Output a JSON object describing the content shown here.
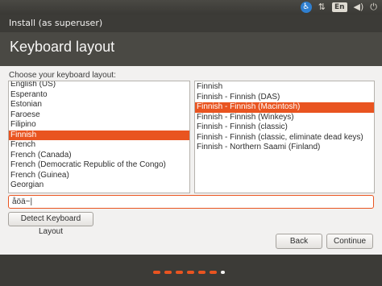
{
  "panel": {
    "icons": [
      "accessibility-icon",
      "network-arrows-icon",
      "keyboard-indicator",
      "volume-icon",
      "power-icon"
    ],
    "keyboard_indicator": "En"
  },
  "window": {
    "title": "Install (as superuser)"
  },
  "header": {
    "title": "Keyboard layout"
  },
  "main": {
    "choose_label": "Choose your keyboard layout:",
    "layouts": [
      "English (US)",
      "Esperanto",
      "Estonian",
      "Faroese",
      "Filipino",
      "Finnish",
      "French",
      "French (Canada)",
      "French (Democratic Republic of the Congo)",
      "French (Guinea)",
      "Georgian"
    ],
    "layouts_selected": "Finnish",
    "variants": [
      "Finnish",
      "Finnish - Finnish (DAS)",
      "Finnish - Finnish (Macintosh)",
      "Finnish - Finnish (Winkeys)",
      "Finnish - Finnish (classic)",
      "Finnish - Finnish (classic, eliminate dead keys)",
      "Finnish - Northern Saami (Finland)"
    ],
    "variants_selected": "Finnish - Finnish (Macintosh)",
    "test_value": "åöä~|",
    "detect_label": "Detect Keyboard Layout",
    "back_label": "Back",
    "continue_label": "Continue"
  },
  "progress": {
    "steps": 7,
    "current_step": 7
  },
  "colors": {
    "accent": "#e95420",
    "panel": "#3c3b37",
    "content_bg": "#f2f1f0"
  }
}
